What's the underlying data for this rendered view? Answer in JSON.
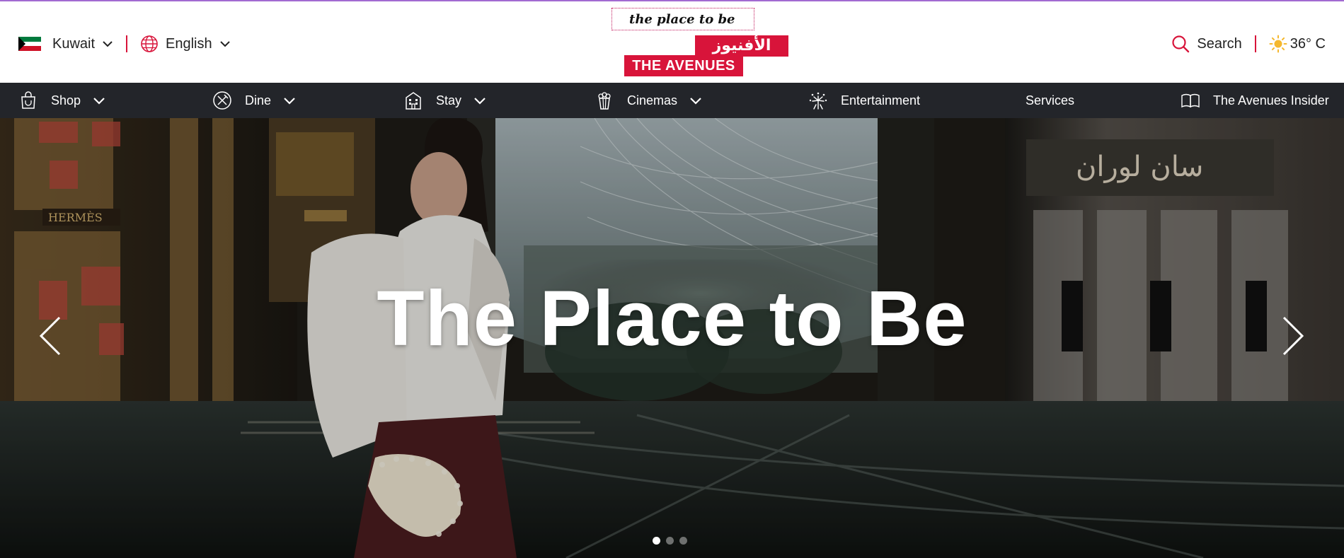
{
  "header": {
    "country": "Kuwait",
    "language": "English",
    "search_label": "Search",
    "temperature": "36° C",
    "accent_color": "#d8143a"
  },
  "logo": {
    "tagline": "the place to be",
    "arabic_name": "الأفنيوز",
    "english_name": "THE AVENUES"
  },
  "nav": {
    "items": [
      {
        "label": "Shop",
        "icon": "shopping-bag-icon",
        "dropdown": true
      },
      {
        "label": "Dine",
        "icon": "fork-knife-icon",
        "dropdown": true
      },
      {
        "label": "Stay",
        "icon": "hotel-building-icon",
        "dropdown": true
      },
      {
        "label": "Cinemas",
        "icon": "popcorn-icon",
        "dropdown": true
      },
      {
        "label": "Entertainment",
        "icon": "fireworks-icon",
        "dropdown": false
      },
      {
        "label": "Services",
        "icon": "",
        "dropdown": false
      },
      {
        "label": "The Avenues Insider",
        "icon": "open-book-icon",
        "dropdown": false
      }
    ]
  },
  "hero": {
    "title": "The Place to Be",
    "slides_total": 3,
    "active_slide": 1
  }
}
